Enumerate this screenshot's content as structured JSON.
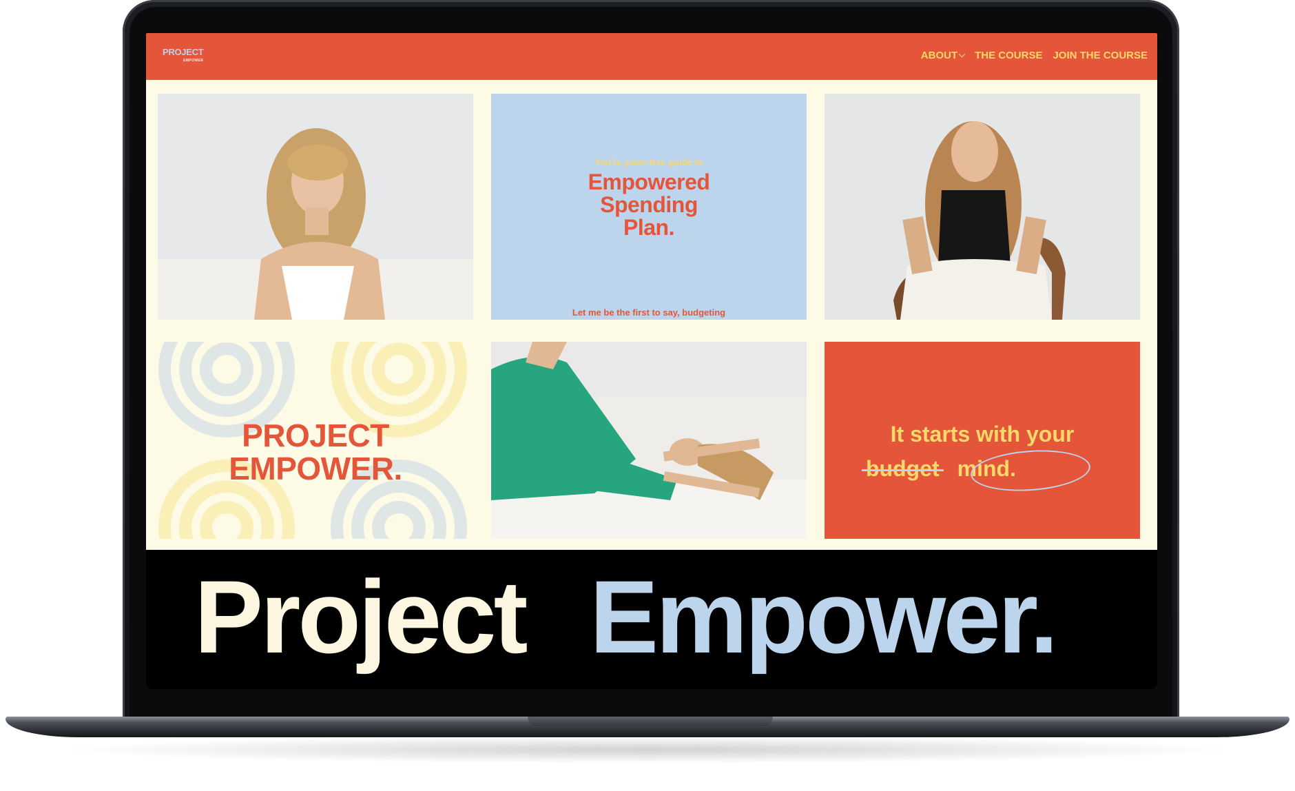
{
  "nav": {
    "logo_main": "PROJECT",
    "logo_sub": "EMPOWER",
    "items": [
      {
        "label": "ABOUT"
      },
      {
        "label": "THE COURSE"
      },
      {
        "label": "JOIN THE COURSE"
      }
    ]
  },
  "tiles": {
    "guide": {
      "kicker": "You're yawn-free guide to",
      "headline_1": "Empowered",
      "headline_2": "Spending",
      "headline_3": "Plan.",
      "footer": "Let me be the first to say, budgeting"
    },
    "brand": {
      "line_1": "PROJECT",
      "line_2": "EMPOWER."
    },
    "mindset": {
      "line_1": "It starts with your",
      "crossed": "budget",
      "replacement": "mind."
    }
  },
  "banner": {
    "word_1": "Project",
    "word_2": "Empower."
  },
  "colors": {
    "accent": "#e4553a",
    "yellow": "#fbd86a",
    "blue": "#bcd4ec",
    "cream": "#fdfae6"
  }
}
